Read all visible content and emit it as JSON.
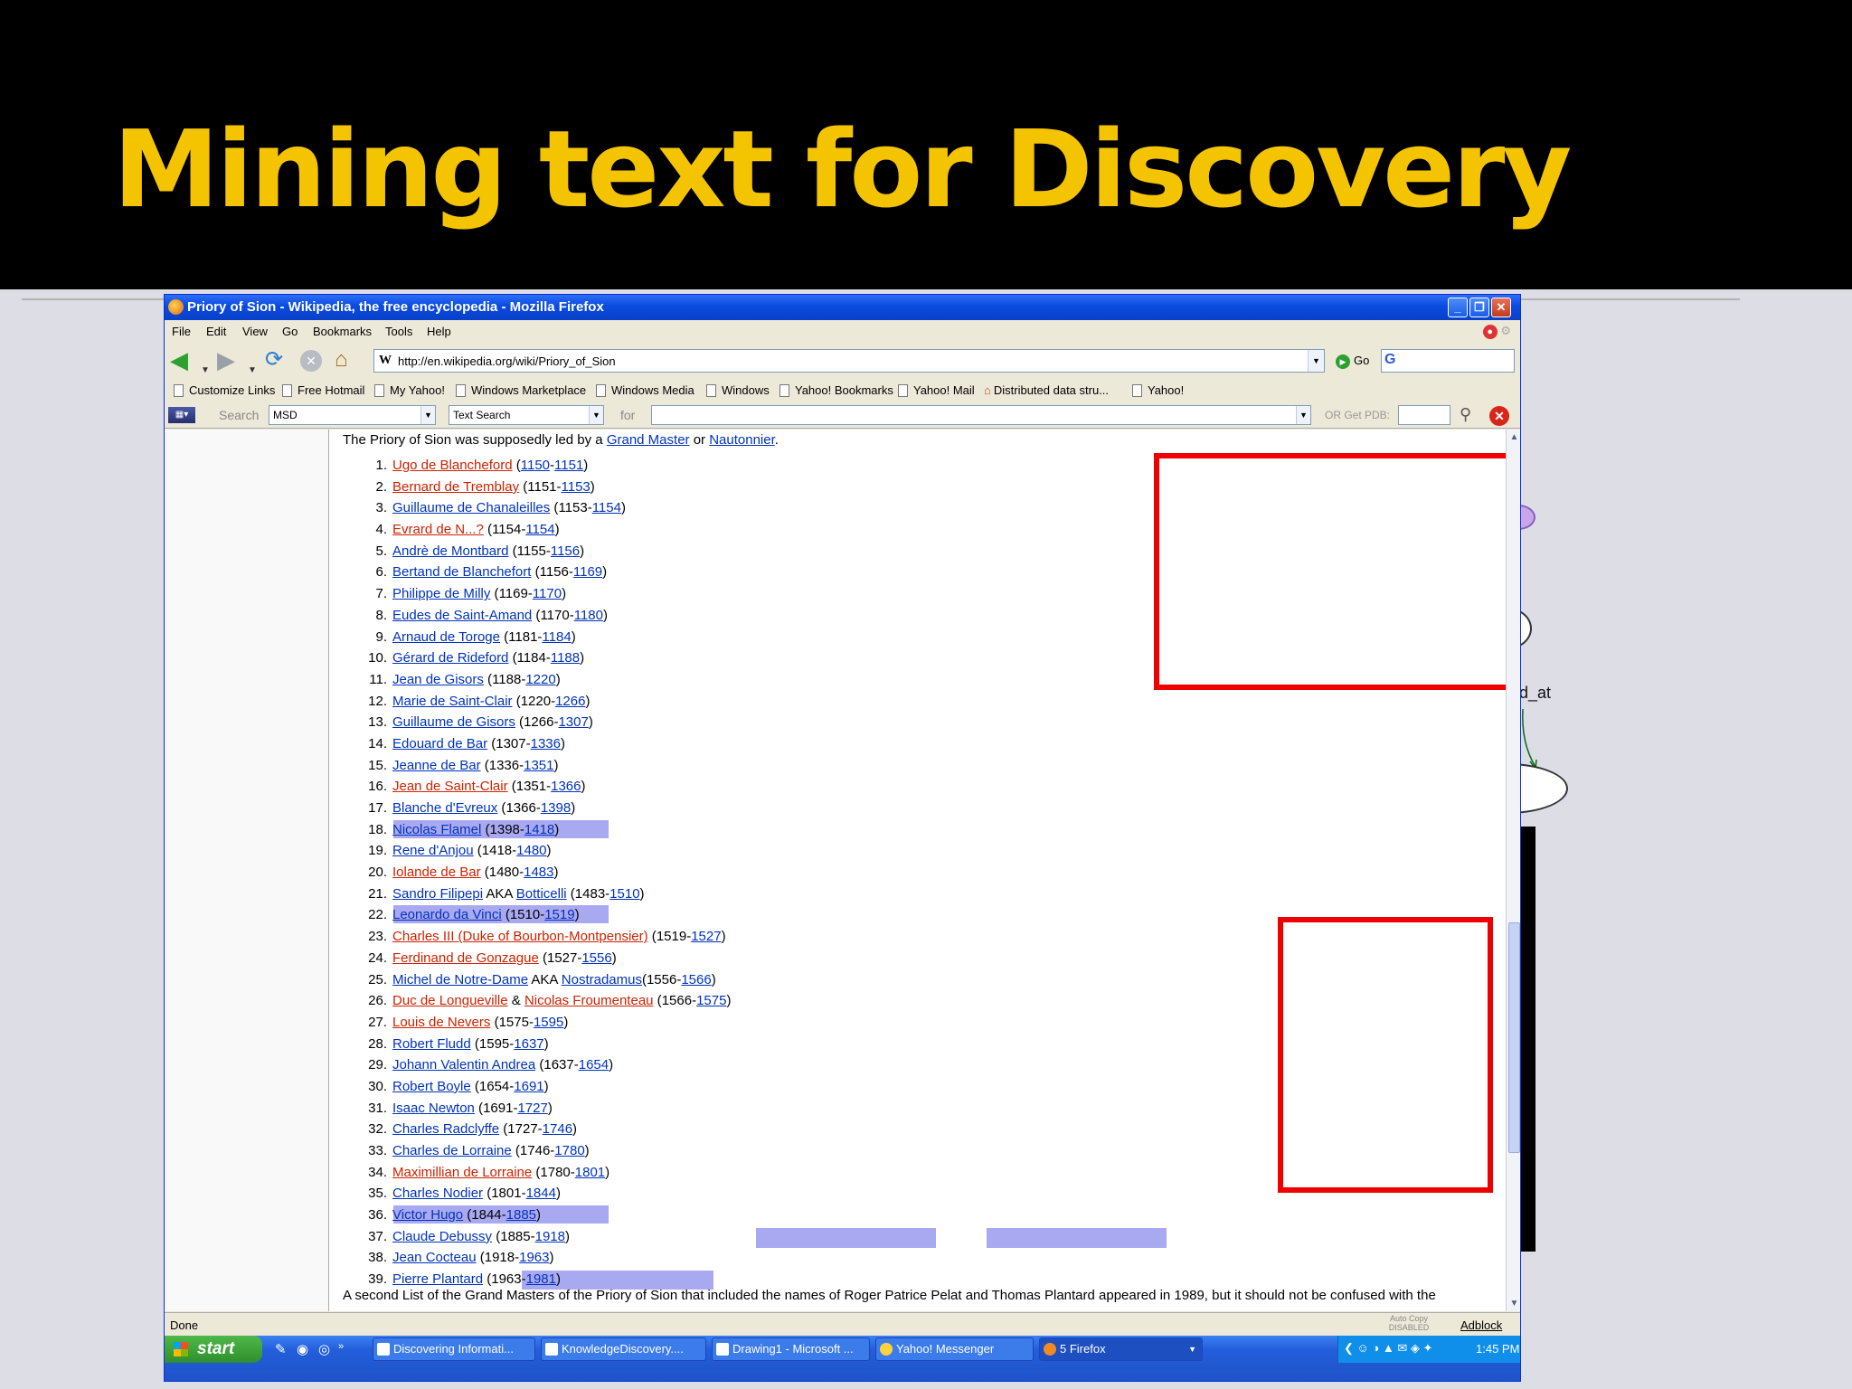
{
  "slide": {
    "title": "Mining text for Discovery"
  },
  "diagram_fragment": {
    "label": "d_at"
  },
  "browser": {
    "title": "Priory of Sion - Wikipedia, the free encyclopedia - Mozilla Firefox",
    "menu": [
      "File",
      "Edit",
      "View",
      "Go",
      "Bookmarks",
      "Tools",
      "Help"
    ],
    "url": "http://en.wikipedia.org/wiki/Priory_of_Sion",
    "go_label": "Go",
    "bookmarks": [
      "Customize Links",
      "Free Hotmail",
      "My Yahoo!",
      "Windows Marketplace",
      "Windows Media",
      "Windows",
      "Yahoo! Bookmarks",
      "Yahoo! Mail",
      "Distributed data stru...",
      "Yahoo!"
    ],
    "search_toolbar": {
      "label": "Search",
      "database": "MSD",
      "search_type": "Text Search",
      "for_label": "for",
      "pdb_label": "OR Get PDB:"
    },
    "status": "Done",
    "status_autocopy": "Auto Copy DISABLED",
    "status_adblock": "Adblock"
  },
  "article": {
    "intro_prefix": "The Priory of Sion was supposedly led by a ",
    "intro_link1": "Grand Master",
    "intro_mid": " or ",
    "intro_link2": "Nautonnier",
    "intro_suffix": ".",
    "grand_masters": [
      {
        "n": "1.",
        "name": "Ugo de Blancheford",
        "red": true,
        "y1": "1150",
        "y1_link": true,
        "y2": "1151"
      },
      {
        "n": "2.",
        "name": "Bernard de Tremblay",
        "red": true,
        "y1": "1151",
        "y1_link": false,
        "y2": "1153"
      },
      {
        "n": "3.",
        "name": "Guillaume de Chanaleilles",
        "red": false,
        "y1": "1153",
        "y1_link": false,
        "y2": "1154"
      },
      {
        "n": "4.",
        "name": "Evrard de N...?",
        "red": true,
        "y1": "1154",
        "y1_link": false,
        "y2": "1154"
      },
      {
        "n": "5.",
        "name": "Andrè de Montbard",
        "red": false,
        "y1": "1155",
        "y1_link": false,
        "y2": "1156"
      },
      {
        "n": "6.",
        "name": "Bertand de Blanchefort",
        "red": false,
        "y1": "1156",
        "y1_link": false,
        "y2": "1169"
      },
      {
        "n": "7.",
        "name": "Philippe de Milly",
        "red": false,
        "y1": "1169",
        "y1_link": false,
        "y2": "1170"
      },
      {
        "n": "8.",
        "name": "Eudes de Saint-Amand",
        "red": false,
        "y1": "1170",
        "y1_link": false,
        "y2": "1180"
      },
      {
        "n": "9.",
        "name": "Arnaud de Toroge",
        "red": false,
        "y1": "1181",
        "y1_link": false,
        "y2": "1184"
      },
      {
        "n": "10.",
        "name": "Gérard de Rideford",
        "red": false,
        "y1": "1184",
        "y1_link": false,
        "y2": "1188"
      },
      {
        "n": "11.",
        "name": "Jean de Gisors",
        "red": false,
        "y1": "1188",
        "y1_link": false,
        "y2": "1220"
      },
      {
        "n": "12.",
        "name": "Marie de Saint-Clair",
        "red": false,
        "y1": "1220",
        "y1_link": false,
        "y2": "1266"
      },
      {
        "n": "13.",
        "name": "Guillaume de Gisors",
        "red": false,
        "y1": "1266",
        "y1_link": false,
        "y2": "1307"
      },
      {
        "n": "14.",
        "name": "Edouard de Bar",
        "red": false,
        "y1": "1307",
        "y1_link": false,
        "y2": "1336"
      },
      {
        "n": "15.",
        "name": "Jeanne de Bar",
        "red": false,
        "y1": "1336",
        "y1_link": false,
        "y2": "1351"
      },
      {
        "n": "16.",
        "name": "Jean de Saint-Clair",
        "red": true,
        "y1": "1351",
        "y1_link": false,
        "y2": "1366"
      },
      {
        "n": "17.",
        "name": "Blanche d'Evreux",
        "red": false,
        "y1": "1366",
        "y1_link": false,
        "y2": "1398"
      },
      {
        "n": "18.",
        "name": "Nicolas Flamel",
        "red": false,
        "y1": "1398",
        "y1_link": false,
        "y2": "1418",
        "hl": true
      },
      {
        "n": "19.",
        "name": "Rene d'Anjou",
        "red": false,
        "y1": "1418",
        "y1_link": false,
        "y2": "1480"
      },
      {
        "n": "20.",
        "name": "Iolande de Bar",
        "red": true,
        "y1": "1480",
        "y1_link": false,
        "y2": "1483"
      },
      {
        "n": "21.",
        "name": "Sandro Filipepi",
        "aka": "Botticelli",
        "red": false,
        "y1": "1483",
        "y1_link": false,
        "y2": "1510"
      },
      {
        "n": "22.",
        "name": "Leonardo da Vinci",
        "red": false,
        "y1": "1510",
        "y1_link": false,
        "y2": "1519",
        "hl": true
      },
      {
        "n": "23.",
        "name": "Charles III (Duke of Bourbon-Montpensier)",
        "red": true,
        "y1": "1519",
        "y1_link": false,
        "y2": "1527"
      },
      {
        "n": "24.",
        "name": "Ferdinand de Gonzague",
        "red": true,
        "y1": "1527",
        "y1_link": false,
        "y2": "1556"
      },
      {
        "n": "25.",
        "name": "Michel de Notre-Dame",
        "aka": "Nostradamus",
        "red": false,
        "y1": "1556",
        "y1_link": false,
        "y2": "1566"
      },
      {
        "n": "26.",
        "name": "Duc de Longueville",
        "and": "Nicolas Froumenteau",
        "red": true,
        "y1": "1566",
        "y1_link": false,
        "y2": "1575"
      },
      {
        "n": "27.",
        "name": "Louis de Nevers",
        "red": true,
        "y1": "1575",
        "y1_link": false,
        "y2": "1595"
      },
      {
        "n": "28.",
        "name": "Robert Fludd",
        "red": false,
        "y1": "1595",
        "y1_link": false,
        "y2": "1637"
      },
      {
        "n": "29.",
        "name": "Johann Valentin Andrea",
        "red": false,
        "y1": "1637",
        "y1_link": false,
        "y2": "1654"
      },
      {
        "n": "30.",
        "name": "Robert Boyle",
        "red": false,
        "y1": "1654",
        "y1_link": false,
        "y2": "1691"
      },
      {
        "n": "31.",
        "name": "Isaac Newton",
        "red": false,
        "y1": "1691",
        "y1_link": false,
        "y2": "1727"
      },
      {
        "n": "32.",
        "name": "Charles Radclyffe",
        "red": false,
        "y1": "1727",
        "y1_link": false,
        "y2": "1746"
      },
      {
        "n": "33.",
        "name": "Charles de Lorraine",
        "red": false,
        "y1": "1746",
        "y1_link": false,
        "y2": "1780"
      },
      {
        "n": "34.",
        "name": "Maximillian de Lorraine",
        "red": true,
        "y1": "1780",
        "y1_link": false,
        "y2": "1801"
      },
      {
        "n": "35.",
        "name": "Charles Nodier",
        "red": false,
        "y1": "1801",
        "y1_link": false,
        "y2": "1844"
      },
      {
        "n": "36.",
        "name": "Victor Hugo",
        "red": false,
        "y1": "1844",
        "y1_link": false,
        "y2": "1885",
        "hl": true
      },
      {
        "n": "37.",
        "name": "Claude Debussy",
        "red": false,
        "y1": "1885",
        "y1_link": false,
        "y2": "1918"
      },
      {
        "n": "38.",
        "name": "Jean Cocteau",
        "red": false,
        "y1": "1918",
        "y1_link": false,
        "y2": "1963"
      },
      {
        "n": "39.",
        "name": "Pierre Plantard",
        "red": false,
        "y1": "1963",
        "y1_link": false,
        "y2": "1981"
      }
    ],
    "footer_text": "A second List of the Grand Masters of the Priory of Sion that included the names of Roger Patrice Pelat and Thomas Plantard appeared in 1989, but it should not be confused with the"
  },
  "taskbar": {
    "start_label": "start",
    "tasks": [
      "Discovering Informati...",
      "KnowledgeDiscovery....",
      "Drawing1 - Microsoft ...",
      "Yahoo! Messenger",
      "5 Firefox"
    ],
    "clock": "1:45 PM"
  }
}
